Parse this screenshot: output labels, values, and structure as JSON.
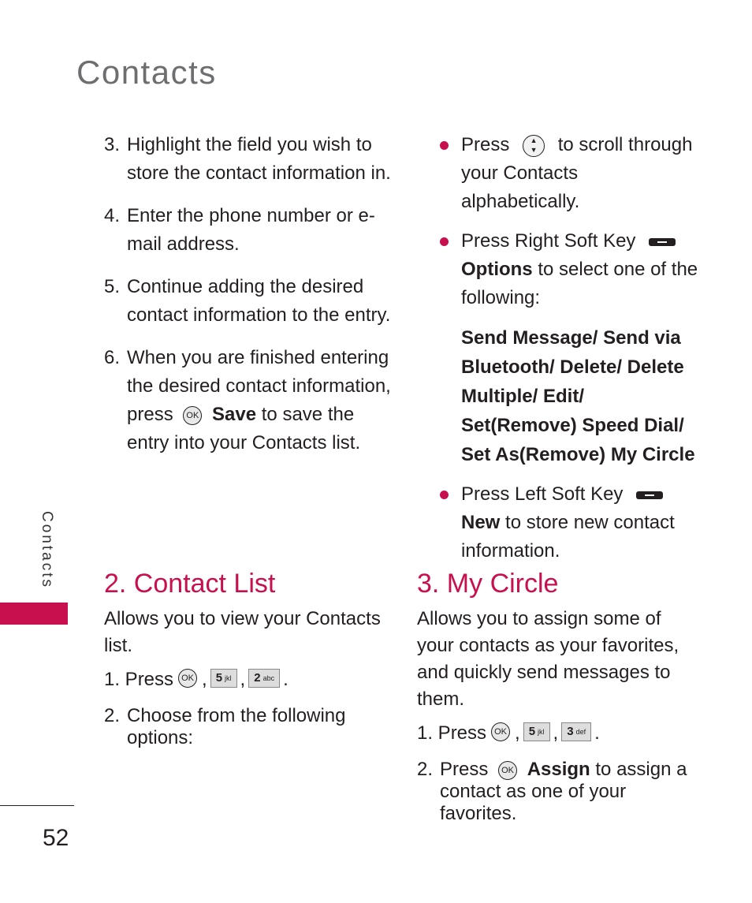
{
  "page": {
    "title": "Contacts",
    "side_label": "Contacts",
    "page_number": "52",
    "accent_color": "#c8104e"
  },
  "left_steps": [
    {
      "num": "3.",
      "text": "Highlight the field you wish to store the contact information in."
    },
    {
      "num": "4.",
      "text": "Enter the phone number or e-mail address."
    },
    {
      "num": "5.",
      "text": "Continue adding the desired contact information to the entry."
    },
    {
      "num": "6.",
      "pre": "When you are finished entering the desired contact information, press",
      "icon": "OK",
      "bold": "Save",
      "post": "to save the entry into your Contacts list."
    }
  ],
  "right_bullets": [
    {
      "pre": "Press",
      "icon": "nav-key",
      "post": "to scroll through your Contacts alphabetically."
    },
    {
      "pre": "Press Right Soft Key",
      "icon": "right-soft-key",
      "bold": "Options",
      "post": "to select one of the following:"
    },
    {
      "pre": "Press Left Soft Key",
      "icon": "left-soft-key",
      "bold": "New",
      "post": "to store new contact information."
    }
  ],
  "options_list": "Send Message/ Send via Bluetooth/ Delete/ Delete Multiple/ Edit/ Set(Remove) Speed Dial/ Set As(Remove) My Circle",
  "contact_list": {
    "heading": "2. Contact List",
    "description": "Allows you to view your Contacts list.",
    "step1_label": "1. Press",
    "step1_keys": [
      "OK",
      "5",
      "jkl",
      "2",
      "abc"
    ],
    "step2_num": "2.",
    "step2_text": "Choose from the following options:"
  },
  "my_circle": {
    "heading": "3. My Circle",
    "description": "Allows you to assign some of your contacts as your favorites, and quickly send messages to them.",
    "step1_label": "1. Press",
    "step1_keys": [
      "OK",
      "5",
      "jkl",
      "3",
      "def"
    ],
    "step2_num": "2.",
    "step2_pre": "Press",
    "step2_icon": "OK",
    "step2_bold": "Assign",
    "step2_post": "to assign a contact as one of your favorites."
  }
}
